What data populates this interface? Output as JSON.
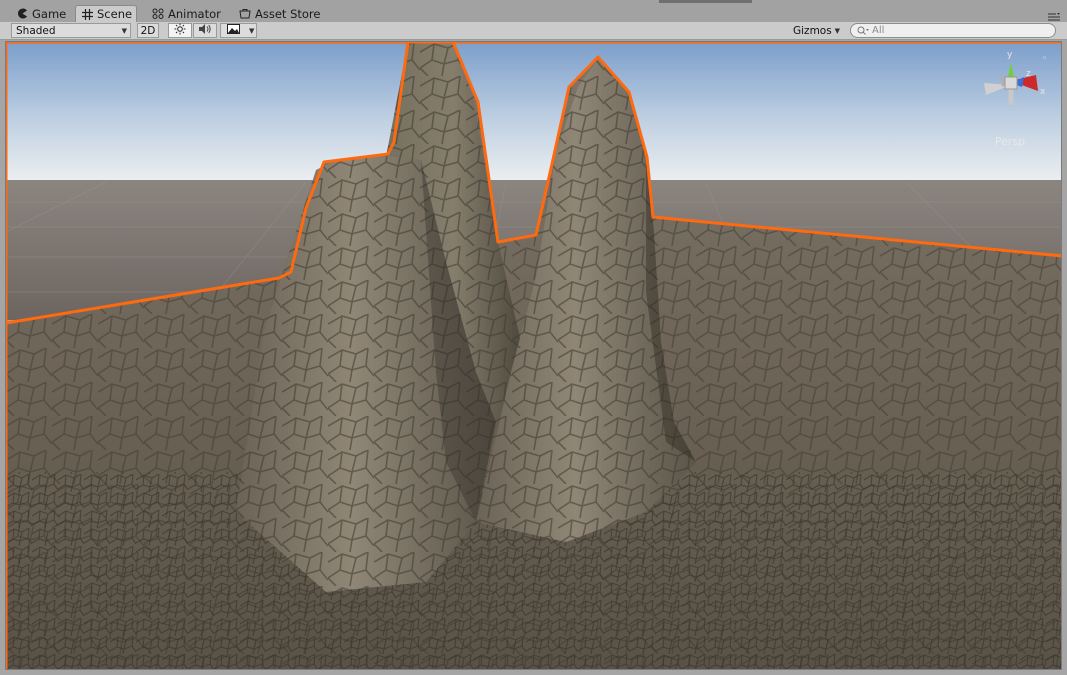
{
  "tabs": [
    {
      "label": "Game",
      "icon": "pacman-icon",
      "active": false
    },
    {
      "label": "Scene",
      "icon": "grid-icon",
      "active": true
    },
    {
      "label": "Animator",
      "icon": "nodes-icon",
      "active": false
    },
    {
      "label": "Asset Store",
      "icon": "shop-icon",
      "active": false
    }
  ],
  "toolbar": {
    "shading_mode": "Shaded",
    "mode_2d": "2D",
    "lighting_icon": "sun-icon",
    "audio_icon": "speaker-icon",
    "effects_icon": "image-icon",
    "gizmos_label": "Gizmos",
    "search_placeholder": "All"
  },
  "scene_view": {
    "projection_label": "Persp",
    "gizmo_axes": {
      "x": "x",
      "y": "y",
      "z": "z"
    },
    "colors": {
      "selection_outline": "#ff6a10",
      "sky_top": "#7fa1c9",
      "sky_horizon": "#e9ecef",
      "ground_far": "#77706b",
      "terrain": "#7d7465",
      "gizmo_x": "#cc2a2a",
      "gizmo_y": "#6fd22c",
      "gizmo_z": "#3a6fd8"
    }
  }
}
